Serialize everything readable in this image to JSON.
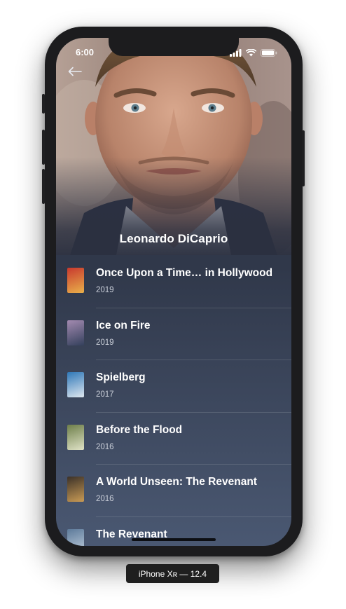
{
  "status_bar": {
    "time": "6:00"
  },
  "actor": {
    "name": "Leonardo DiCaprio"
  },
  "films": [
    {
      "title": "Once Upon a Time… in Hollywood",
      "year": "2019",
      "poster_colors": [
        "#c8392e",
        "#e9b04a"
      ]
    },
    {
      "title": "Ice on Fire",
      "year": "2019",
      "poster_colors": [
        "#a38ab0",
        "#34405c"
      ]
    },
    {
      "title": "Spielberg",
      "year": "2017",
      "poster_colors": [
        "#2f78b8",
        "#dfe7ef"
      ]
    },
    {
      "title": "Before the Flood",
      "year": "2016",
      "poster_colors": [
        "#6e7f4a",
        "#dfe2c6"
      ]
    },
    {
      "title": "A World Unseen: The Revenant",
      "year": "2016",
      "poster_colors": [
        "#3b3128",
        "#c99b55"
      ]
    },
    {
      "title": "The Revenant",
      "year": "",
      "poster_colors": [
        "#5d7a9a",
        "#c2d0de"
      ]
    }
  ],
  "device_label": "iPhone Xʀ — 12.4",
  "colors": {
    "screen_top": "#2b3040",
    "screen_bottom": "#4a5872",
    "text_primary": "#ffffff",
    "text_secondary": "#c9ced8"
  }
}
